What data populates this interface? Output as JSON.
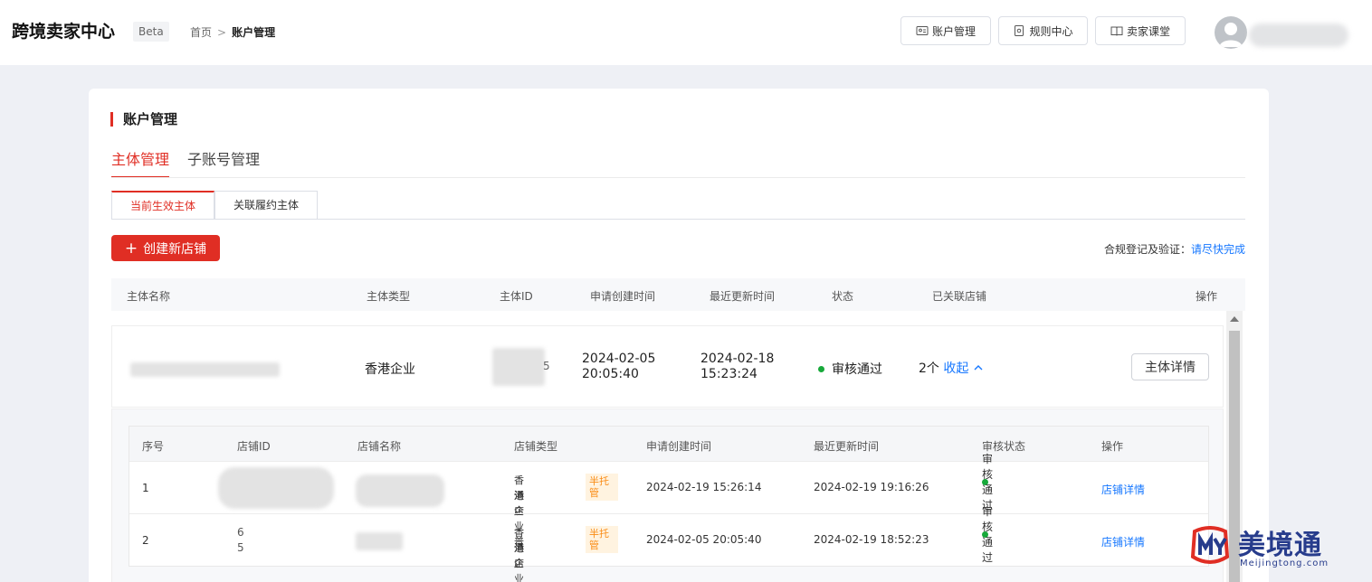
{
  "header": {
    "brand": "跨境卖家中心",
    "beta": "Beta",
    "breadcrumb": {
      "home": "首页",
      "separator": ">",
      "current": "账户管理"
    },
    "buttons": {
      "account": "账户管理",
      "rules": "规则中心",
      "classroom": "卖家课堂"
    }
  },
  "page": {
    "section_title": "账户管理",
    "main_tabs": [
      "主体管理",
      "子账号管理"
    ],
    "sub_tabs": [
      "当前生效主体",
      "关联履约主体"
    ],
    "create_button": "创建新店铺",
    "compliance_label": "合规登记及验证：",
    "compliance_link": "请尽快完成"
  },
  "table": {
    "columns": [
      "主体名称",
      "主体类型",
      "主体ID",
      "申请创建时间",
      "最近更新时间",
      "状态",
      "已关联店铺",
      "操作"
    ]
  },
  "entity": {
    "type": "香港企业",
    "id_partial": "5",
    "created": {
      "date": "2024-02-05",
      "time": "20:05:40"
    },
    "updated": {
      "date": "2024-02-18",
      "time": "15:23:24"
    },
    "status": "审核通过",
    "store_count": "2个",
    "collapse_label": "收起",
    "detail_button": "主体详情"
  },
  "stores": {
    "columns": [
      "序号",
      "店铺ID",
      "店铺名称",
      "店铺类型",
      "申请创建时间",
      "最近更新时间",
      "审核状态",
      "操作"
    ],
    "rows": [
      {
        "index": "1",
        "type_line1": "香港企业普",
        "type_line2": "通店",
        "tag_line1": "半托",
        "tag_line2": "管",
        "created": "2024-02-19 15:26:14",
        "updated": "2024-02-19 19:16:26",
        "status": "审核通过",
        "action": "店铺详情"
      },
      {
        "index": "2",
        "id_line1": "6",
        "id_line2": "5",
        "type_line1": "香港企业普",
        "type_line2": "通店",
        "tag_line1": "半托",
        "tag_line2": "管",
        "created": "2024-02-05 20:05:40",
        "updated": "2024-02-19 18:52:23",
        "status": "审核通过",
        "action": "店铺详情"
      }
    ]
  },
  "logo": {
    "text": "美境通",
    "sub": "Meijingtong.com"
  },
  "colors": {
    "accent": "#e02e24",
    "link": "#1677ff",
    "success": "#17a93a",
    "tag": "#fa8c16",
    "logo": "#273c8c"
  }
}
